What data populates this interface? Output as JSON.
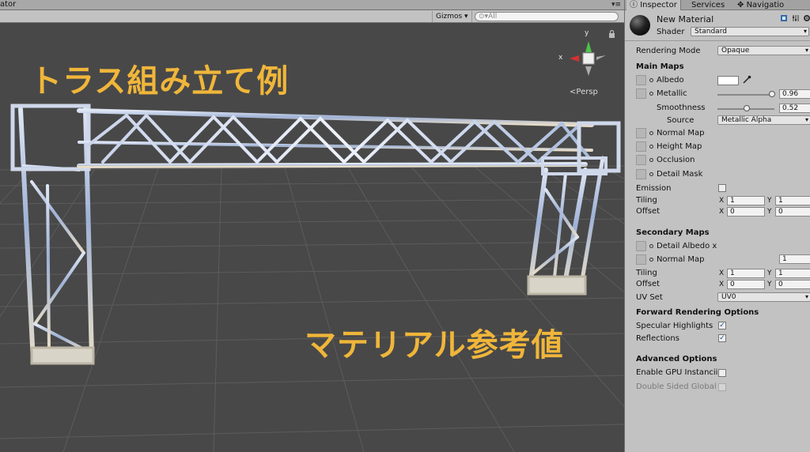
{
  "scene": {
    "tab_label": "ator",
    "tab_menu": "▾≡",
    "gizmos_label": "Gizmos ▾",
    "search_placeholder": "All",
    "overlay_title": "トラス組み立て例",
    "overlay_subtitle": "マテリアル参考値",
    "persp_label": "Persp",
    "gizmo_x": "x",
    "gizmo_y": "y",
    "accent": "#f0b63a"
  },
  "inspector": {
    "tabs": [
      {
        "label": "Inspector",
        "icon": "info-icon"
      },
      {
        "label": "Services"
      },
      {
        "label": "Navigatio",
        "icon": "navigation-icon"
      }
    ],
    "material_name": "New Material",
    "shader_label": "Shader",
    "shader_value": "Standard",
    "rendering_mode_label": "Rendering Mode",
    "rendering_mode_value": "Opaque",
    "main_maps_header": "Main Maps",
    "albedo_label": "Albedo",
    "metallic_label": "Metallic",
    "metallic_value": "0.96",
    "metallic_fraction": 0.96,
    "smoothness_label": "Smoothness",
    "smoothness_value": "0.52",
    "smoothness_fraction": 0.52,
    "source_label": "Source",
    "source_value": "Metallic Alpha",
    "normal_map_label": "Normal Map",
    "height_map_label": "Height Map",
    "occlusion_label": "Occlusion",
    "detail_mask_label": "Detail Mask",
    "emission_label": "Emission",
    "tiling_label": "Tiling",
    "offset_label": "Offset",
    "x_label": "X",
    "y_label": "Y",
    "main_tiling_x": "1",
    "main_tiling_y": "1",
    "main_offset_x": "0",
    "main_offset_y": "0",
    "secondary_maps_header": "Secondary Maps",
    "detail_albedo_label": "Detail Albedo x",
    "sec_normal_map_label": "Normal Map",
    "sec_normal_value": "1",
    "sec_tiling_x": "1",
    "sec_tiling_y": "1",
    "sec_offset_x": "0",
    "sec_offset_y": "0",
    "uv_set_label": "UV Set",
    "uv_set_value": "UV0",
    "forward_header": "Forward Rendering Options",
    "specular_label": "Specular Highlights",
    "reflections_label": "Reflections",
    "advanced_header": "Advanced Options",
    "gpu_instancing_label": "Enable GPU Instancii",
    "double_sided_label": "Double Sided Global",
    "check_mark": "✓"
  }
}
